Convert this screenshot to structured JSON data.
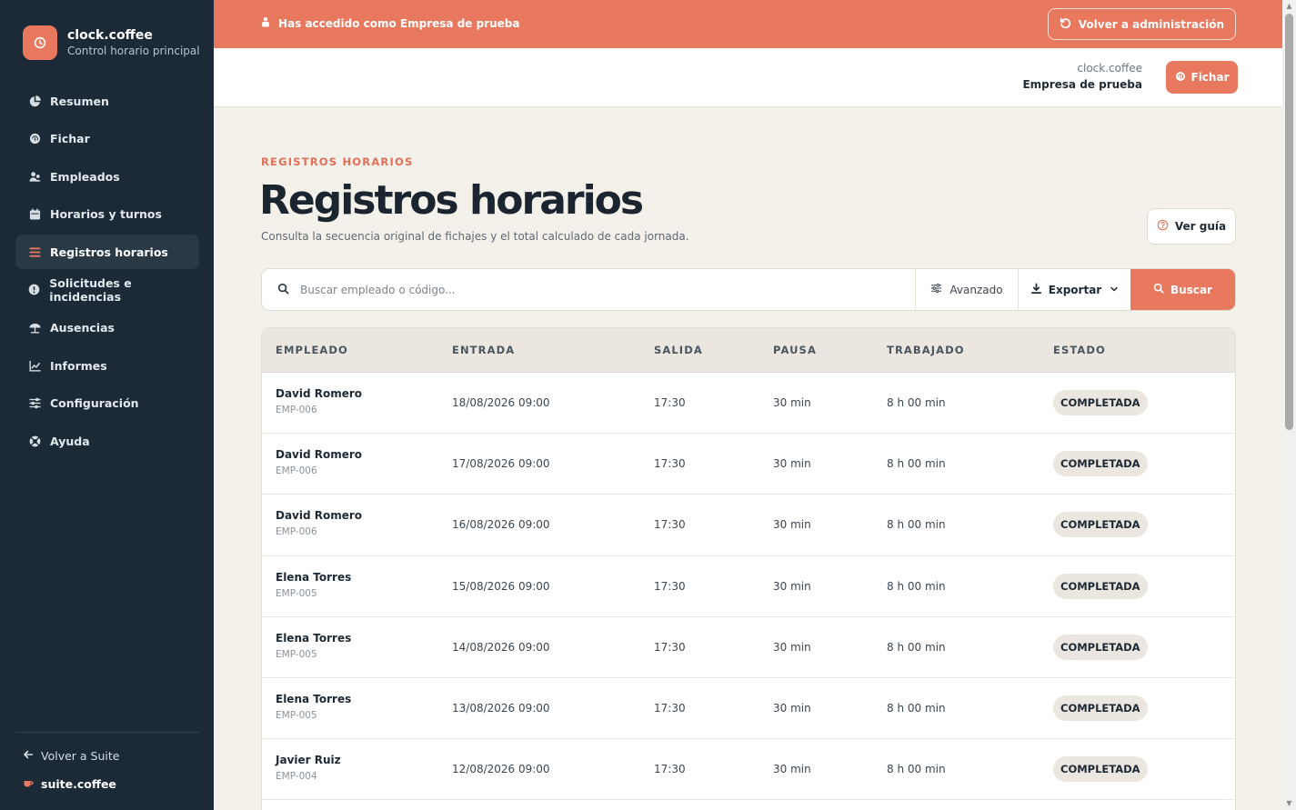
{
  "brand": {
    "name": "clock.coffee",
    "subtitle": "Control horario principal"
  },
  "sidebar": {
    "items": [
      {
        "label": "Resumen",
        "icon": "pie-chart-icon",
        "active": false
      },
      {
        "label": "Fichar",
        "icon": "fingerprint-icon",
        "active": false
      },
      {
        "label": "Empleados",
        "icon": "users-icon",
        "active": false
      },
      {
        "label": "Horarios y turnos",
        "icon": "calendar-icon",
        "active": false
      },
      {
        "label": "Registros horarios",
        "icon": "list-icon",
        "active": true
      },
      {
        "label": "Solicitudes e incidencias",
        "icon": "alert-icon",
        "active": false
      },
      {
        "label": "Ausencias",
        "icon": "umbrella-icon",
        "active": false
      },
      {
        "label": "Informes",
        "icon": "chart-icon",
        "active": false
      },
      {
        "label": "Configuración",
        "icon": "sliders-icon",
        "active": false
      },
      {
        "label": "Ayuda",
        "icon": "lifebuoy-icon",
        "active": false
      }
    ],
    "back_label": "Volver a Suite",
    "suite_label": "suite.coffee"
  },
  "impersonation": {
    "text": "Has accedido como Empresa de prueba",
    "button_label": "Volver a administración"
  },
  "header": {
    "app_name": "clock.coffee",
    "company_name": "Empresa de prueba",
    "fichar_label": "Fichar"
  },
  "page": {
    "eyebrow": "REGISTROS HORARIOS",
    "title": "Registros horarios",
    "subtitle": "Consulta la secuencia original de fichajes y el total calculado de cada jornada.",
    "guide_label": "Ver guía"
  },
  "search": {
    "placeholder": "Buscar empleado o código...",
    "advanced_label": "Avanzado",
    "export_label": "Exportar",
    "search_label": "Buscar"
  },
  "table": {
    "headers": {
      "employee": "EMPLEADO",
      "entry": "ENTRADA",
      "exit": "SALIDA",
      "pause": "PAUSA",
      "worked": "TRABAJADO",
      "status": "ESTADO"
    },
    "rows": [
      {
        "name": "David Romero",
        "code": "EMP-006",
        "entry": "18/08/2026 09:00",
        "exit": "17:30",
        "pause": "30 min",
        "worked": "8 h 00 min",
        "status": "COMPLETADA"
      },
      {
        "name": "David Romero",
        "code": "EMP-006",
        "entry": "17/08/2026 09:00",
        "exit": "17:30",
        "pause": "30 min",
        "worked": "8 h 00 min",
        "status": "COMPLETADA"
      },
      {
        "name": "David Romero",
        "code": "EMP-006",
        "entry": "16/08/2026 09:00",
        "exit": "17:30",
        "pause": "30 min",
        "worked": "8 h 00 min",
        "status": "COMPLETADA"
      },
      {
        "name": "Elena Torres",
        "code": "EMP-005",
        "entry": "15/08/2026 09:00",
        "exit": "17:30",
        "pause": "30 min",
        "worked": "8 h 00 min",
        "status": "COMPLETADA"
      },
      {
        "name": "Elena Torres",
        "code": "EMP-005",
        "entry": "14/08/2026 09:00",
        "exit": "17:30",
        "pause": "30 min",
        "worked": "8 h 00 min",
        "status": "COMPLETADA"
      },
      {
        "name": "Elena Torres",
        "code": "EMP-005",
        "entry": "13/08/2026 09:00",
        "exit": "17:30",
        "pause": "30 min",
        "worked": "8 h 00 min",
        "status": "COMPLETADA"
      },
      {
        "name": "Javier Ruiz",
        "code": "EMP-004",
        "entry": "12/08/2026 09:00",
        "exit": "17:30",
        "pause": "30 min",
        "worked": "8 h 00 min",
        "status": "COMPLETADA"
      }
    ]
  },
  "colors": {
    "accent": "#e8785e",
    "sidebar_bg": "#1c2a37",
    "page_bg": "#f4f1eb"
  }
}
